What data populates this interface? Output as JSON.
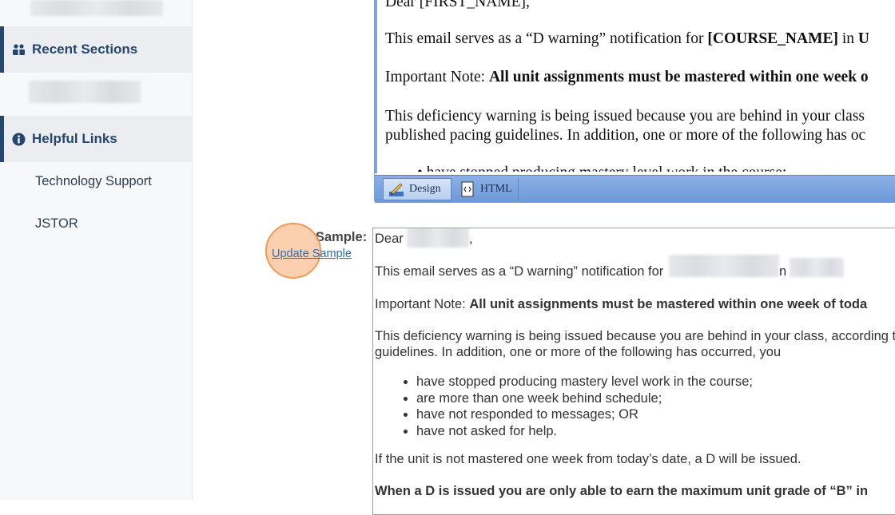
{
  "sidebar": {
    "sections": [
      {
        "label": "Recent Sections",
        "icon": "user-group-icon"
      },
      {
        "label": "Helpful Links",
        "icon": "info-circle-icon"
      }
    ],
    "links": [
      "Technology Support",
      "JSTOR"
    ]
  },
  "editor": {
    "greeting": "Dear [FIRST_NAME],",
    "line1_pre": "This email serves as a “D warning” notification for ",
    "line1_bold": "[COURSE_NAME]",
    "line1_post": " in ",
    "line1_cut": "U",
    "line2_pre": "Important Note: ",
    "line2_bold": "All unit assignments must be mastered within one week o",
    "line3": "This deficiency warning is being issued because you are behind in your class",
    "line4": "published pacing guidelines. In addition, one or more of the following has oc",
    "line5_cut": "•   have stopped producing mastery level work in the course;",
    "toolbar": {
      "design": "Design",
      "html": "HTML"
    }
  },
  "sample": {
    "label": "Sample:",
    "update_link": "Update Sample",
    "greeting": "Dear",
    "greeting_tail": ",",
    "line1_pre": "This email serves as a “D warning” notification for",
    "line1_mid": "n",
    "note_pre": "Important Note: ",
    "note_bold": "All unit assignments must be mastered within one week of toda",
    "para1": "This deficiency warning is being issued because you are behind in your class, according t",
    "para2": "guidelines. In addition, one or more of the following has occurred, you",
    "bullets": [
      "have stopped producing mastery level work in the course;",
      "are more than one week behind schedule;",
      "have not responded to messages; OR",
      "have not asked for help."
    ],
    "line_d": "If the unit is not mastered one week from today’s date, a D will be issued.",
    "line_last_bold": "When a D is issued you are only able to earn the maximum unit grade of “B” in"
  },
  "colors": {
    "accent": "#25476f",
    "link": "#2a6fb7",
    "toolbar": "#7ea6db",
    "highlight": "#f29a58"
  }
}
